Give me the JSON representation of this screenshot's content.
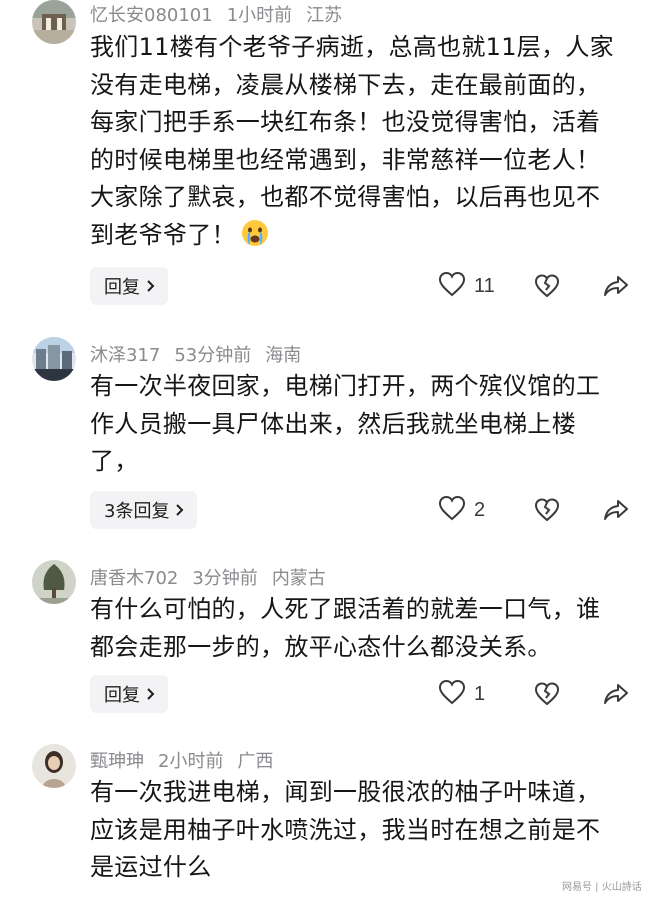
{
  "comments": [
    {
      "username": "忆长安080101",
      "time": "1小时前",
      "location": "江苏",
      "lines": [
        "我们11楼有个老爷子病逝，总高也就11层，人家",
        "没有走电梯，凌晨从楼梯下去，走在最前面的，",
        "每家门把手系一块红布条！也没觉得害怕，活着",
        "的时候电梯里也经常遇到，非常慈祥一位老人！",
        "大家除了默哀，也都不觉得害怕，以后再也见不",
        "到老爷爷了！"
      ],
      "emoji": "crying-face-icon",
      "reply_label": "回复",
      "likes": "11"
    },
    {
      "username": "沐泽317",
      "time": "53分钟前",
      "location": "海南",
      "lines": [
        "有一次半夜回家，电梯门打开，两个殡仪馆的工",
        "作人员搬一具尸体出来，然后我就坐电梯上楼",
        "了，"
      ],
      "reply_label": "3条回复",
      "likes": "2"
    },
    {
      "username": "唐香木702",
      "time": "3分钟前",
      "location": "内蒙古",
      "lines": [
        "有什么可怕的，人死了跟活着的就差一口气，谁",
        "都会走那一步的，放平心态什么都没关系。"
      ],
      "reply_label": "回复",
      "likes": "1"
    },
    {
      "username": "甄珅珅",
      "time": "2小时前",
      "location": "广西",
      "lines": [
        "有一次我进电梯，闻到一股很浓的柚子叶味道，",
        "应该是用柚子叶水喷洗过，我当时在想之前是不",
        "是运过什么"
      ]
    }
  ],
  "watermark": "网易号 | 火山詩话",
  "colors": {
    "meta": "#8a8a8f",
    "text": "#161616",
    "reply_bg": "#f3f3f5"
  }
}
